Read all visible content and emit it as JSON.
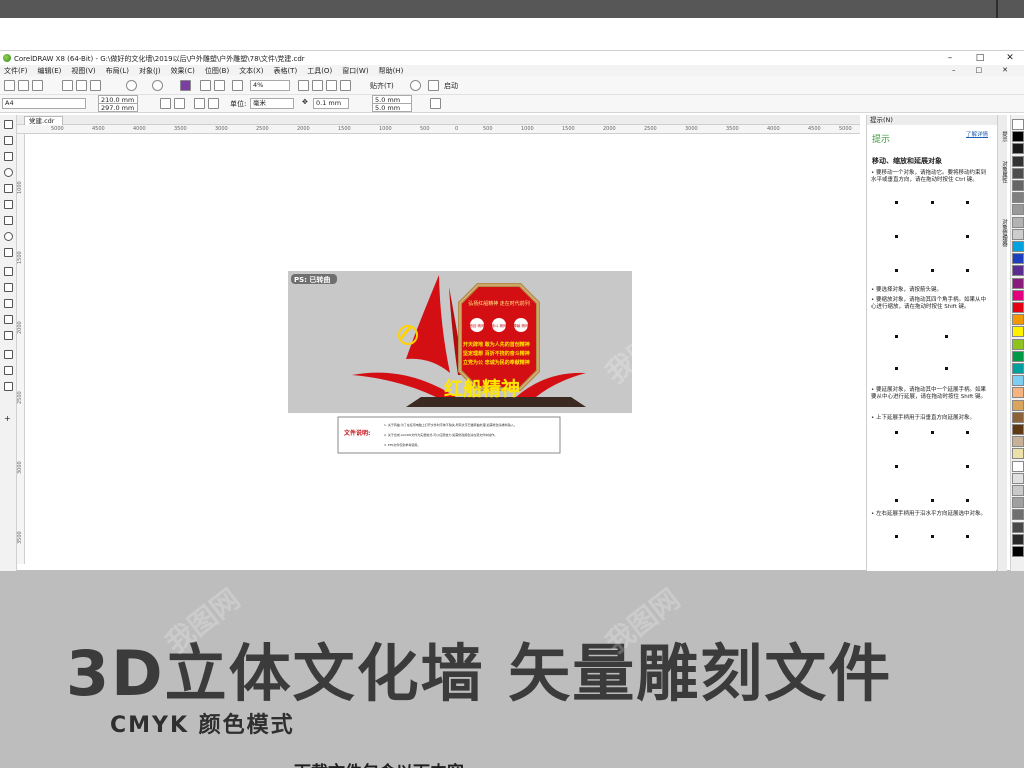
{
  "window": {
    "title": "CorelDRAW X8 (64-Bit) - G:\\做好的文化墙\\2019以后\\户外雕塑\\户外雕塑\\78\\文件\\党建.cdr",
    "min_glyph": "–",
    "max_glyph": "□",
    "close_glyph": "✕"
  },
  "menu": [
    "文件(F)",
    "编辑(E)",
    "视图(V)",
    "布局(L)",
    "对象(J)",
    "效果(C)",
    "位图(B)",
    "文本(X)",
    "表格(T)",
    "工具(O)",
    "窗口(W)",
    "帮助(H)"
  ],
  "menu_right": [
    "–",
    "□",
    "✕"
  ],
  "toolbar1": {
    "zoom": "4%",
    "snap": "贴齐(T)",
    "launch": "启动"
  },
  "toolbar2": {
    "page_size": "A4",
    "width": "210.0 mm",
    "height": "297.0 mm",
    "units_label": "单位:",
    "units": "毫米",
    "nudge": "0.1 mm",
    "dup_x": "5.0 mm",
    "dup_y": "5.0 mm"
  },
  "document_tab": "党建.cdr",
  "ruler_h": [
    "5000",
    "4500",
    "4000",
    "3500",
    "3000",
    "2500",
    "2000",
    "1500",
    "1000",
    "500",
    "0",
    "500",
    "1000",
    "1500",
    "2000",
    "2500",
    "3000",
    "3500",
    "4000",
    "4500",
    "5000"
  ],
  "ruler_v": [
    "1000",
    "1500",
    "2000",
    "2500",
    "3000",
    "3500"
  ],
  "artwork": {
    "tag": "PS: 已转曲",
    "top_label": "弘扬红船精神\n走在时代前列",
    "circles": [
      "首创\n精神",
      "奋斗\n精神",
      "奉献\n精神"
    ],
    "rows": [
      "开天辟地 敢为人先的首创精神",
      "坚定理想 百折不挠的奋斗精神",
      "立党为公 忠诚为民的奉献精神"
    ],
    "big_text": "红船精神"
  },
  "file_note": {
    "title": "文件说明:",
    "lines": [
      "1. 关于转曲:为了在任何电脑上打开文件时字体不缺失,所有文字已做转曲处理,如需修改请重新输入。",
      "2. 关于合成:AI/CDR文件为矢量格式,可以任意放大;如需修改颜色请在源文件中操作。",
      "3. EPS文件仅供参考使用。"
    ]
  },
  "hints": {
    "header": "提示(N)",
    "title": "提示",
    "link": "了解详情",
    "section": "移动、缩放和延展对象",
    "p1": "• 要移动一个对象，请拖动它。要将移动约束到水平或垂直方向，请在拖动时按住 Ctrl 键。",
    "p2": "• 要选择对象，请按箭头键。",
    "p3": "• 要缩放对象，请拖动其四个角手柄。如果从中心进行缩放，请在拖动时按住 Shift 键。",
    "p4": "• 要延展对象，请拖动其中一个延展手柄。如果要从中心进行延展，请在拖动时按住 Shift 键。",
    "p5": "• 上下延展手柄用于沿垂直方向延展对象。",
    "p6": "• 左右延展手柄用于沿水平方向延展选中对象。"
  },
  "side_tabs": [
    "提示",
    "对象属性",
    "对象管理器"
  ],
  "palette": [
    "#ffffff",
    "#000000",
    "#1a1a1a",
    "#333333",
    "#4d4d4d",
    "#666666",
    "#808080",
    "#999999",
    "#b3b3b3",
    "#cccccc",
    "#00a3e0",
    "#1d3fbf",
    "#5b2d90",
    "#8a1c7c",
    "#e4007f",
    "#e60012",
    "#f39800",
    "#fff100",
    "#8fc31f",
    "#009944",
    "#00a0a0",
    "#7ecef4",
    "#f6b37f",
    "#d9a45b",
    "#8c6239",
    "#603813",
    "#c7b299",
    "#ebe1a9",
    "#ffffff",
    "#e0e0e0",
    "#c9c9c9",
    "#a0a0a0",
    "#707070",
    "#4a4a4a",
    "#2a2a2a",
    "#000000"
  ],
  "promo": {
    "headline": "3D立体文化墙  矢量雕刻文件",
    "subtitle": "CMYK 颜色模式",
    "cut_line": "下载文件包含以下内容"
  },
  "watermark": "我图网"
}
